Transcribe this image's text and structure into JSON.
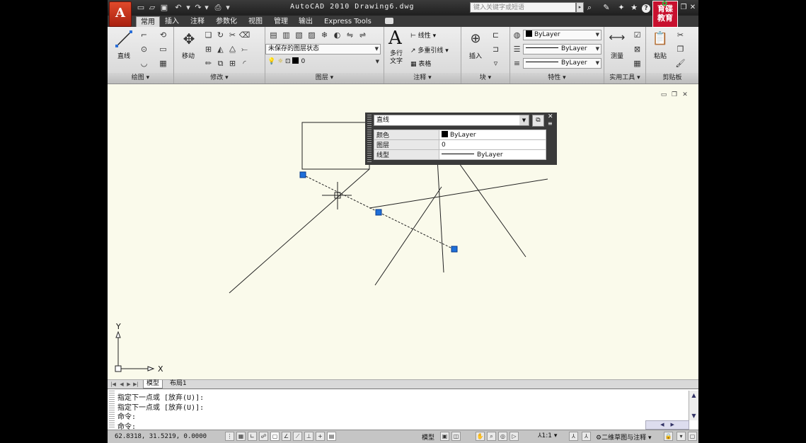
{
  "app": {
    "title": "AutoCAD 2010    Drawing6.dwg",
    "logo_letter": "A",
    "search_placeholder": "键入关键字或短语",
    "brand_text_1": "育",
    "brand_text_2": "碟",
    "brand_text_3": "教",
    "brand_text_4": "育"
  },
  "tabs": [
    {
      "label": "常用"
    },
    {
      "label": "插入"
    },
    {
      "label": "注释"
    },
    {
      "label": "参数化"
    },
    {
      "label": "视图"
    },
    {
      "label": "管理"
    },
    {
      "label": "输出"
    },
    {
      "label": "Express Tools"
    }
  ],
  "ribbon": {
    "draw": {
      "title": "绘图 ▾",
      "line_label": "直线"
    },
    "modify": {
      "title": "修改 ▾",
      "move_label": "移动"
    },
    "layers": {
      "title": "图层 ▾",
      "state_value": "未保存的图层状态",
      "layer_value": "0"
    },
    "annotation": {
      "title": "注释 ▾",
      "mtext_label_1": "多行",
      "mtext_label_2": "文字",
      "linear_label": "线性",
      "mleader_label": "多重引线",
      "table_label": "表格"
    },
    "block": {
      "title": "块 ▾",
      "insert_label": "插入"
    },
    "properties": {
      "title": "特性 ▾",
      "color_value": "ByLayer",
      "linetype_value": "ByLayer",
      "lineweight_value": "ByLayer"
    },
    "utilities": {
      "title": "实用工具 ▾",
      "measure_label": "测量"
    },
    "clipboard": {
      "title": "剪贴板",
      "paste_label": "粘贴"
    }
  },
  "quick_properties": {
    "object_type": "直线",
    "rows": [
      {
        "key": "颜色",
        "value": "ByLayer"
      },
      {
        "key": "图层",
        "value": "0"
      },
      {
        "key": "线型",
        "value": "ByLayer"
      }
    ]
  },
  "ucs": {
    "x_label": "X",
    "y_label": "Y"
  },
  "layout_tabs": [
    {
      "label": "模型"
    },
    {
      "label": "布局1"
    }
  ],
  "command": {
    "lines": [
      "指定下一点或 [放弃(U)]:",
      "指定下一点或 [放弃(U)]:",
      "命令:",
      "命令:"
    ]
  },
  "status": {
    "coordinates": "62.8318, 31.5219, 0.0000",
    "model_label": "模型",
    "scale_label": "1:1",
    "workspace_label": "二维草图与注释"
  },
  "colors": {
    "canvas": "#fafaeb",
    "grip": "#1e6fd9",
    "accent_red": "#c8102e"
  }
}
